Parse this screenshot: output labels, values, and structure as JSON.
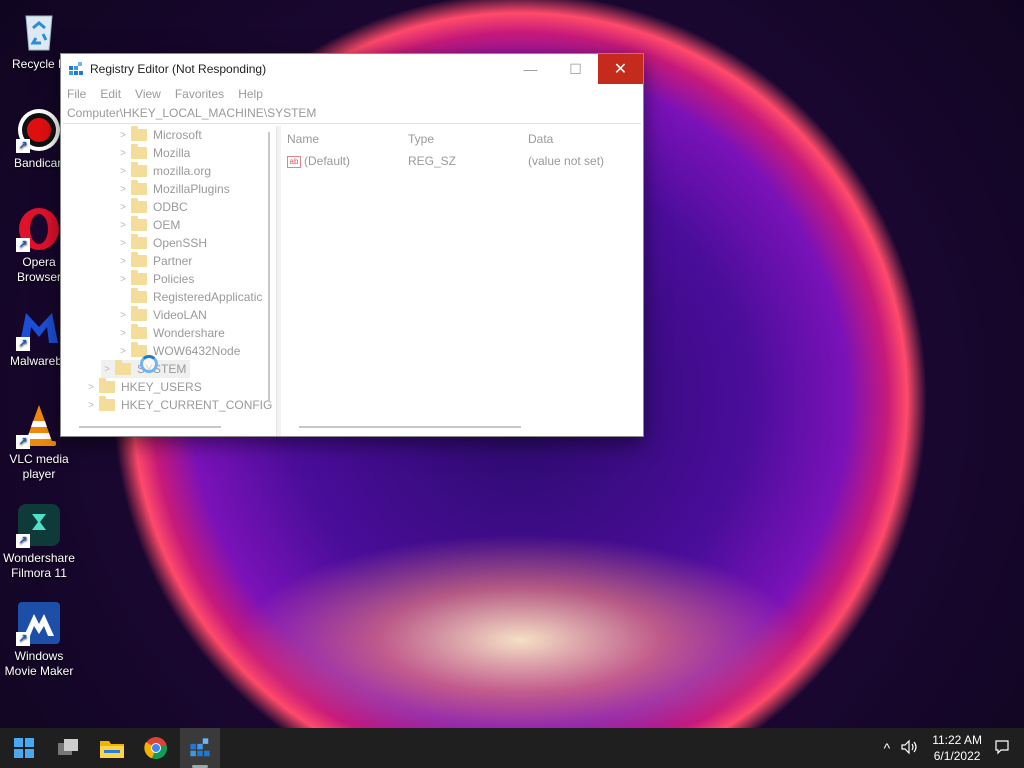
{
  "desktop": {
    "icons": [
      {
        "label": "Recycle B",
        "icon": "recycle-bin-icon"
      },
      {
        "label": "Bandican",
        "icon": "bandicam-icon"
      },
      {
        "label": "Opera Browser",
        "icon": "opera-icon"
      },
      {
        "label": "Malwareby",
        "icon": "malwarebytes-icon"
      },
      {
        "label": "VLC media player",
        "icon": "vlc-icon"
      },
      {
        "label": "Wondershare Filmora 11",
        "icon": "filmora-icon"
      },
      {
        "label": "Windows Movie Maker",
        "icon": "movie-maker-icon"
      }
    ]
  },
  "window": {
    "title": "Registry Editor (Not Responding)",
    "minimize": "—",
    "maximize": "☐",
    "close": "✕",
    "menu": [
      "File",
      "Edit",
      "View",
      "Favorites",
      "Help"
    ],
    "address": "Computer\\HKEY_LOCAL_MACHINE\\SYSTEM"
  },
  "tree": {
    "items": [
      {
        "label": "Microsoft",
        "expander": ">"
      },
      {
        "label": "Mozilla",
        "expander": ">"
      },
      {
        "label": "mozilla.org",
        "expander": ">"
      },
      {
        "label": "MozillaPlugins",
        "expander": ">"
      },
      {
        "label": "ODBC",
        "expander": ">"
      },
      {
        "label": "OEM",
        "expander": ">"
      },
      {
        "label": "OpenSSH",
        "expander": ">"
      },
      {
        "label": "Partner",
        "expander": ">"
      },
      {
        "label": "Policies",
        "expander": ">"
      },
      {
        "label": "RegisteredApplicatic",
        "expander": ""
      },
      {
        "label": "VideoLAN",
        "expander": ">"
      },
      {
        "label": "Wondershare",
        "expander": ">"
      },
      {
        "label": "WOW6432Node",
        "expander": ">"
      },
      {
        "label": "SYSTEM",
        "expander": ">"
      },
      {
        "label": "HKEY_USERS",
        "expander": ">"
      },
      {
        "label": "HKEY_CURRENT_CONFIG",
        "expander": ">"
      }
    ]
  },
  "list": {
    "columns": [
      "Name",
      "Type",
      "Data"
    ],
    "rows": [
      {
        "name": "(Default)",
        "type": "REG_SZ",
        "data": "(value not set)",
        "type_icon": "ab"
      }
    ]
  },
  "taskbar": {
    "time": "11:22 AM",
    "date": "6/1/2022",
    "chevron": "^"
  }
}
